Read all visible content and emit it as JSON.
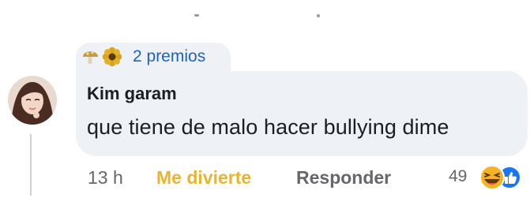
{
  "comment": {
    "awards_label": "2 premios",
    "author": "Kim garam",
    "text": "que tiene de malo hacer bullying dime",
    "time": "13 h",
    "reaction_label": "Me divierte",
    "reply_label": "Responder",
    "reaction_count": "49"
  },
  "icons": {
    "awards": [
      "mushroom-icon",
      "flower-icon"
    ],
    "reactions": [
      "haha-reaction-icon",
      "like-reaction-icon"
    ]
  },
  "colors": {
    "bubble": "#eef1f5",
    "awards_text": "#1b63c9",
    "reaction_active": "#e9b430",
    "meta": "#65676b",
    "like": "#1877f2",
    "haha": "#f7b125"
  }
}
